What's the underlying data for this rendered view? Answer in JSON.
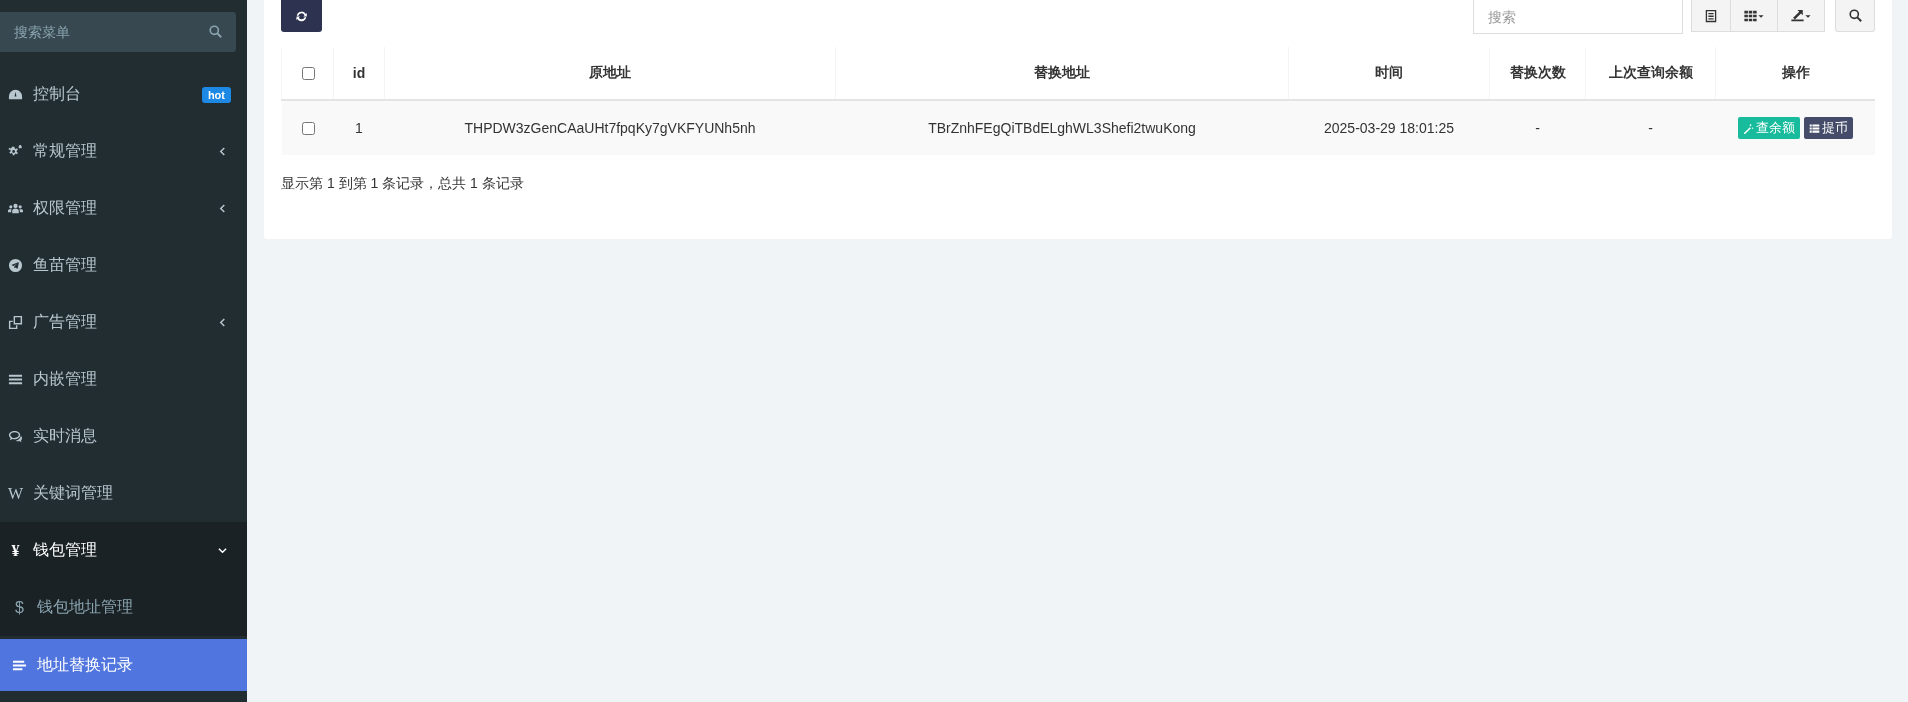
{
  "sidebar": {
    "search": {
      "placeholder": "搜索菜单"
    },
    "menu": [
      {
        "label": "控制台",
        "badge": "hot",
        "selected": false
      },
      {
        "label": "常规管理",
        "expanded": false,
        "selected": false
      },
      {
        "label": "权限管理",
        "expanded": false,
        "selected": false
      },
      {
        "label": "鱼苗管理",
        "selected": false
      },
      {
        "label": "广告管理",
        "expanded": false,
        "selected": false
      },
      {
        "label": "内嵌管理",
        "selected": false
      },
      {
        "label": "实时消息",
        "selected": false
      },
      {
        "label": "关键词管理",
        "icon_char": "W",
        "selected": false
      },
      {
        "label": "钱包管理",
        "icon_char": "¥",
        "expanded": true,
        "selected": false,
        "children": [
          {
            "label": "钱包地址管理",
            "icon_char": "$",
            "selected": false
          },
          {
            "label": "地址替换记录",
            "selected": true
          }
        ]
      }
    ]
  },
  "toolbar": {
    "search": {
      "placeholder": "搜索"
    }
  },
  "table": {
    "header_checkbox": {
      "checked": false
    },
    "columns": [
      "id",
      "原地址",
      "替换地址",
      "时间",
      "替换次数",
      "上次查询余额",
      "操作"
    ],
    "rows": [
      {
        "checked": false,
        "cells": [
          "1",
          "THPDW3zGenCAaUHt7fpqKy7gVKFYUNh5nh",
          "TBrZnhFEgQiTBdELghWL3Shefi2twuKong",
          "2025-03-29 18:01:25",
          "-",
          "-"
        ],
        "actions": [
          {
            "kind": "edit",
            "label": "查余额"
          },
          {
            "kind": "list",
            "label": "提币"
          }
        ]
      }
    ]
  },
  "footer": "显示第 1 到第 1 条记录，总共 1 条记录"
}
